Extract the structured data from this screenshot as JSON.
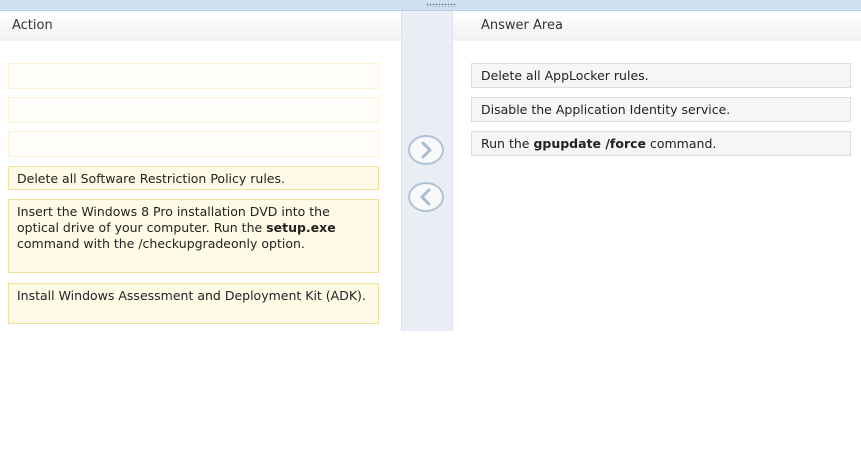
{
  "headers": {
    "action": "Action",
    "answer_area": "Answer Area"
  },
  "actions": [
    {
      "label": ""
    },
    {
      "label": ""
    },
    {
      "label": ""
    },
    {
      "label": "Delete all Software Restriction Policy rules."
    },
    {
      "label_parts": [
        "Insert the Windows 8 Pro installation DVD into the optical drive of your computer. Run the ",
        "setup.exe",
        " command with the /checkupgradeonly option."
      ]
    },
    {
      "label": "Install Windows Assessment and Deployment Kit (ADK)."
    }
  ],
  "answers": [
    {
      "label": "Delete all AppLocker rules."
    },
    {
      "label": "Disable the Application Identity service."
    },
    {
      "label_parts": [
        "Run the ",
        "gpupdate /force",
        " command."
      ]
    }
  ],
  "icons": {
    "move_right": "chevron-right-icon",
    "move_left": "chevron-left-icon"
  }
}
